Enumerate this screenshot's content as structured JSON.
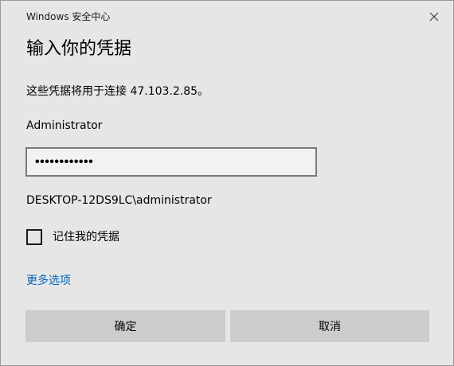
{
  "window": {
    "app_title": "Windows 安全中心",
    "close_icon": "close-icon"
  },
  "dialog": {
    "heading": "输入你的凭据",
    "message": "这些凭据将用于连接 47.103.2.85。",
    "username": "Administrator",
    "password_masked": "••••••••••••",
    "account": "DESKTOP-12DS9LC\\administrator",
    "remember_label": "记住我的凭据",
    "remember_checked": false,
    "more_options": "更多选项"
  },
  "buttons": {
    "ok": "确定",
    "cancel": "取消"
  },
  "colors": {
    "background": "#e6e6e6",
    "link": "#0067c0",
    "button": "#cccccc",
    "field_border": "#7a7a7a"
  }
}
